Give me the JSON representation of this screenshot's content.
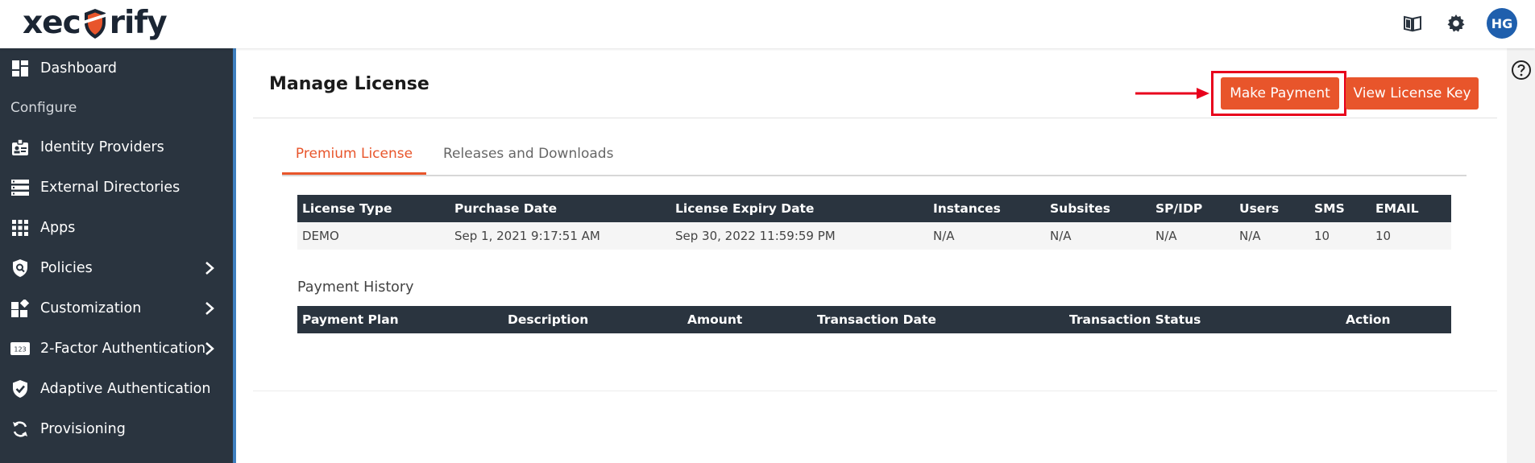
{
  "app": {
    "logo_left": "xec",
    "logo_right": "rify",
    "avatar_initials": "HG"
  },
  "colors": {
    "accent": "#e8552b",
    "sidebar_bg": "#2a343f",
    "avatar_bg": "#1f5fad",
    "highlight": "#e8001c"
  },
  "sidebar": {
    "section_label": "Configure",
    "items": [
      {
        "label": "Dashboard",
        "icon": "dashboard-icon"
      },
      {
        "label": "Identity Providers",
        "icon": "id-badge-icon"
      },
      {
        "label": "External Directories",
        "icon": "directory-icon"
      },
      {
        "label": "Apps",
        "icon": "apps-grid-icon"
      },
      {
        "label": "Policies",
        "icon": "policy-shield-icon"
      },
      {
        "label": "Customization",
        "icon": "customization-icon"
      },
      {
        "label": "2-Factor Authentication",
        "icon": "two-factor-icon"
      },
      {
        "label": "Adaptive Authentication",
        "icon": "adaptive-shield-icon"
      },
      {
        "label": "Provisioning",
        "icon": "sync-icon"
      }
    ]
  },
  "main": {
    "title": "Manage License",
    "make_payment_label": "Make Payment",
    "view_license_key_label": "View License Key",
    "tabs": [
      {
        "label": "Premium License",
        "active": true
      },
      {
        "label": "Releases and Downloads",
        "active": false
      }
    ],
    "license_table": {
      "headers": [
        "License Type",
        "Purchase Date",
        "License Expiry Date",
        "Instances",
        "Subsites",
        "SP/IDP",
        "Users",
        "SMS",
        "EMAIL"
      ],
      "row": [
        "DEMO",
        "Sep 1, 2021 9:17:51 AM",
        "Sep 30, 2022 11:59:59 PM",
        "N/A",
        "N/A",
        "N/A",
        "N/A",
        "10",
        "10"
      ]
    },
    "payment_history": {
      "title": "Payment History",
      "headers": [
        "Payment Plan",
        "Description",
        "Amount",
        "Transaction Date",
        "Transaction Status",
        "Action"
      ]
    }
  }
}
